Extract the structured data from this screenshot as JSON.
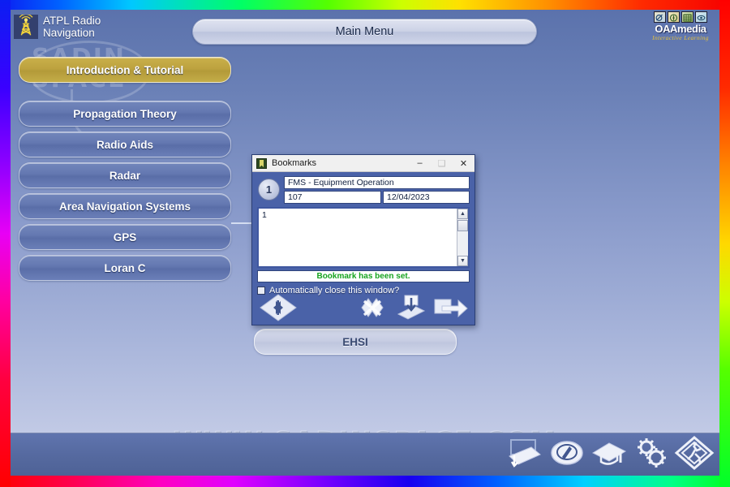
{
  "app": {
    "brand_title": "ATPL Radio\nNavigation",
    "tower_icon": "radio-tower-icon",
    "header_title": "Main Menu",
    "publisher_name": "OAAmedia",
    "publisher_tagline": "Interactive Learning",
    "watermark_url": "WWW.SADINSPACE.COM",
    "watermark_logo_line1": "SADIN",
    "watermark_logo_line2": "SPACE"
  },
  "colors": {
    "accent_gold": "#c4ad48",
    "menu_blue": "#6579b2",
    "status_green": "#16a31f",
    "dialog_border": "#2c3f74"
  },
  "menu": {
    "items": [
      {
        "label": "Introduction & Tutorial",
        "state": "highlighted"
      },
      {
        "label": "Propagation Theory",
        "state": "normal"
      },
      {
        "label": "Radio Aids",
        "state": "normal"
      },
      {
        "label": "Radar",
        "state": "normal"
      },
      {
        "label": "Area Navigation Systems",
        "state": "normal"
      },
      {
        "label": "GPS",
        "state": "normal"
      },
      {
        "label": "Loran C",
        "state": "normal"
      }
    ],
    "submenu_item": "EHSI"
  },
  "dialog": {
    "title": "Bookmarks",
    "app_icon": "bookmarks-window-icon",
    "controls": {
      "minimize": "–",
      "maximize": "❑",
      "close": "✕"
    },
    "badge_number": "1",
    "bookmark_title": "FMS - Equipment Operation",
    "page_number": "107",
    "date": "12/04/2023",
    "list_items": [
      "1"
    ],
    "status_message": "Bookmark has been set.",
    "autoclose_label": "Automatically close this window?",
    "autoclose_checked": false,
    "toolbar": {
      "navigate": "prev-next-arrows-icon",
      "delete": "delete-bookmark-icon",
      "save": "save-bookmark-icon",
      "goto": "goto-bookmark-icon"
    }
  },
  "bottom_bar": {
    "icons": [
      {
        "name": "notes-icon"
      },
      {
        "name": "compass-icon"
      },
      {
        "name": "graduation-cap-icon"
      },
      {
        "name": "settings-gears-icon"
      },
      {
        "name": "exit-icon"
      }
    ]
  }
}
